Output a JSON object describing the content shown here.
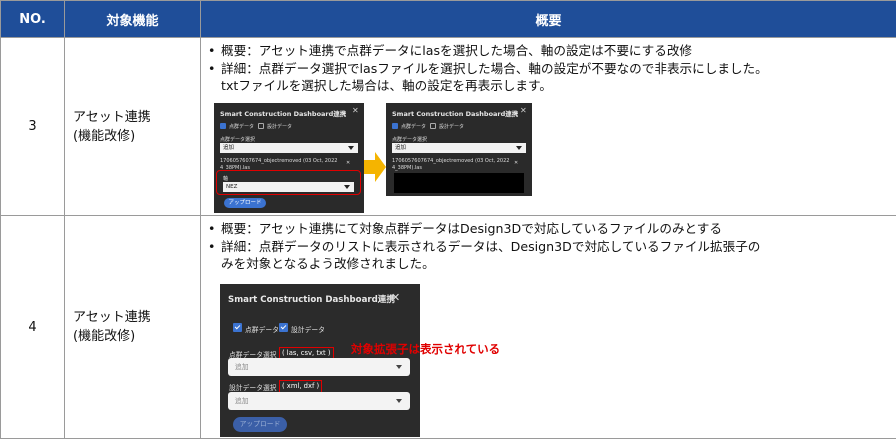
{
  "header": {
    "no": "NO.",
    "func": "対象機能",
    "desc": "概要"
  },
  "rows": [
    {
      "no": "3",
      "func_line1": "アセット連携",
      "func_line2": "(機能改修)",
      "bullets": [
        "概要：アセット連携で点群データにlasを選択した場合、軸の設定は不要にする改修",
        "詳細：点群データ選択でlasファイルを選択した場合、軸の設定が不要なので非表示にしました。"
      ],
      "continuation": "txtファイルを選択した場合は、軸の設定を再表示します。",
      "dialog_before": {
        "title": "Smart Construction Dashboard連携",
        "close": "✕",
        "cb1": "点群データ",
        "cb2": "設計データ",
        "section": "点群データ選択",
        "select_value": "追加",
        "file_line1": "1706057607674_objectremoved (03 Oct, 2022",
        "file_line2": "4_38PM).las",
        "file_close": "✕",
        "axis_label": "軸",
        "axis_value": "NEZ",
        "upload": "アップロード"
      },
      "dialog_after": {
        "title": "Smart Construction Dashboard連携",
        "close": "✕",
        "cb1": "点群データ",
        "cb2": "設計データ",
        "section": "点群データ選択",
        "select_value": "追加",
        "file_line1": "1706057607674_objectremoved (03 Oct, 2022",
        "file_line2": "4_38PM).las",
        "file_close": "✕"
      },
      "arrow_color": "#f5b400"
    },
    {
      "no": "4",
      "func_line1": "アセット連携",
      "func_line2": "(機能改修)",
      "bullets": [
        "概要：アセット連携にて対象点群データはDesign3Dで対応しているファイルのみとする",
        "詳細：点群データのリストに表示されるデータは、Design3Dで対応しているファイル拡張子の"
      ],
      "continuation": "みを対象となるよう改修されました。",
      "dialog": {
        "title": "Smart Construction Dashboard連携",
        "close": "✕",
        "cb1": "点群データ",
        "cb2": "設計データ",
        "pc_label": "点群データ選択",
        "pc_ext": "( las, csv, txt )",
        "pc_placeholder": "追加",
        "design_label": "設計データ選択",
        "design_ext": "( xml, dxf )",
        "design_placeholder": "追加",
        "upload": "アップロード"
      },
      "note": "対象拡張子は表示されている"
    }
  ],
  "colors": {
    "header_bg": "#1f4e99",
    "highlight_red": "#e00000",
    "dialog_bg": "#2b2b2b",
    "accent_blue": "#3b73d1"
  }
}
